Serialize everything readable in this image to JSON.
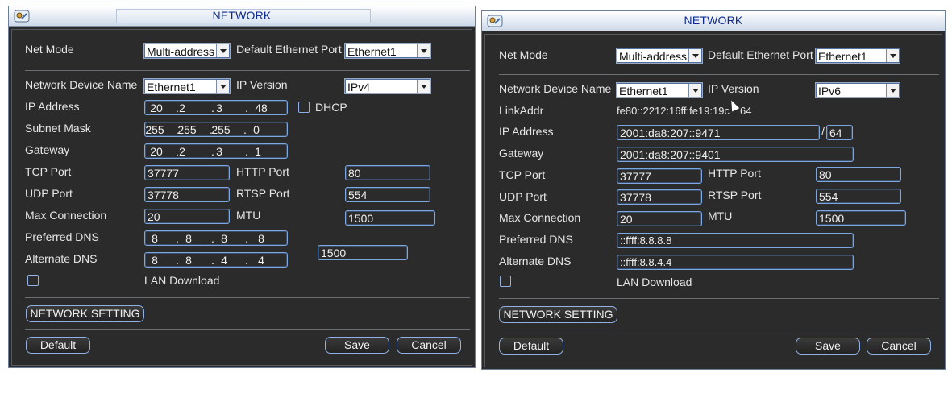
{
  "left": {
    "title": "NETWORK",
    "labels": {
      "net_mode": "Net Mode",
      "default_port": "Default Ethernet Port",
      "device_name": "Network Device Name",
      "ip_version": "IP Version",
      "ip_address": "IP Address",
      "dhcp": "DHCP",
      "subnet": "Subnet Mask",
      "gateway": "Gateway",
      "tcp": "TCP Port",
      "http": "HTTP Port",
      "udp": "UDP Port",
      "rtsp": "RTSP Port",
      "max_conn": "Max Connection",
      "mtu": "MTU",
      "pref_dns": "Preferred DNS",
      "alt_dns": "Alternate DNS",
      "lan_download": "LAN Download"
    },
    "values": {
      "net_mode": "Multi-address",
      "default_port": "Ethernet1",
      "device_name": "Ethernet1",
      "ip_version": "IPv4",
      "ip": [
        "20",
        "2",
        "3",
        "48"
      ],
      "subnet": [
        "255",
        "255",
        "255",
        "0"
      ],
      "gateway": [
        "20",
        "2",
        "3",
        "1"
      ],
      "tcp": "37777",
      "http": "80",
      "udp": "37778",
      "rtsp": "554",
      "max_conn": "20",
      "mtu": "1500",
      "pref_dns": [
        "8",
        "8",
        "8",
        "8"
      ],
      "alt_dns": [
        "8",
        "8",
        "4",
        "4"
      ],
      "extra": "1500"
    },
    "buttons": {
      "network_setting": "NETWORK SETTING",
      "default": "Default",
      "save": "Save",
      "cancel": "Cancel"
    }
  },
  "right": {
    "title": "NETWORK",
    "labels": {
      "net_mode": "Net Mode",
      "default_port": "Default Ethernet Port",
      "device_name": "Network Device Name",
      "ip_version": "IP Version",
      "link_addr": "LinkAddr",
      "ip_address": "IP Address",
      "gateway": "Gateway",
      "tcp": "TCP Port",
      "http": "HTTP Port",
      "udp": "UDP Port",
      "rtsp": "RTSP Port",
      "max_conn": "Max Connection",
      "mtu": "MTU",
      "pref_dns": "Preferred DNS",
      "alt_dns": "Alternate DNS",
      "lan_download": "LAN Download"
    },
    "values": {
      "net_mode": "Multi-address",
      "default_port": "Ethernet1",
      "device_name": "Ethernet1",
      "ip_version": "IPv6",
      "link_addr": "fe80::2212:16ff:fe19:19c",
      "link_addr_tail": "64",
      "ip": "2001:da8:207::9471",
      "prefix_slash": "/",
      "prefix": "64",
      "gateway": "2001:da8:207::9401",
      "tcp": "37777",
      "http": "80",
      "udp": "37778",
      "rtsp": "554",
      "max_conn": "20",
      "mtu": "1500",
      "pref_dns": "::ffff:8.8.8.8",
      "alt_dns": "::ffff:8.8.4.4"
    },
    "buttons": {
      "network_setting": "NETWORK SETTING",
      "default": "Default",
      "save": "Save",
      "cancel": "Cancel"
    }
  },
  "icons": {
    "window": "network-settings-icon",
    "cursor": "mouse-pointer-icon"
  },
  "colors": {
    "panel_bg": "#2b2b2b",
    "field_border": "#7da7e0",
    "title_text": "#0d2b8f"
  }
}
